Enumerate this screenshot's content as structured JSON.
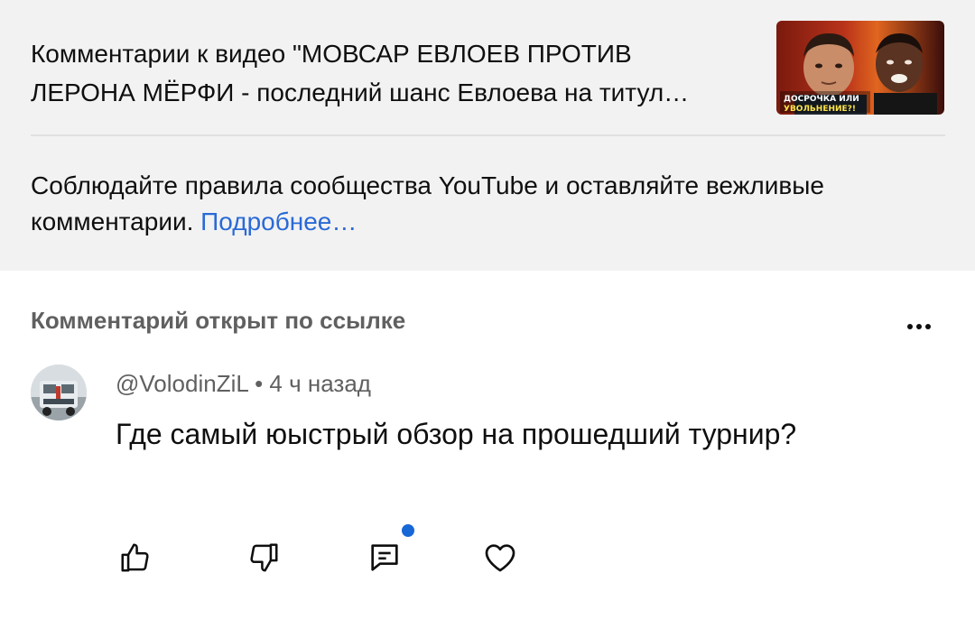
{
  "header": {
    "title_line1": "Комментарии к видео \"МОВСАР ЕВЛОЕВ ПРОТИВ",
    "title_line2": "ЛЕРОНА МЁРФИ - последний шанс Евлоева на титул…",
    "thumbnail_caption_line1": "ДОСРОЧКА ИЛИ",
    "thumbnail_caption_line2": "УВОЛЬНЕНИЕ?!"
  },
  "guidelines": {
    "text": "Соблюдайте правила сообщества YouTube и оставляйте вежливые комментарии.",
    "link": "Подробнее…"
  },
  "comment": {
    "linked_label": "Комментарий открыт по ссылке",
    "author": "@VolodinZiL",
    "separator": " • ",
    "time": "4 ч назад",
    "text": "Где самый юыстрый обзор на прошедший турнир?"
  },
  "colors": {
    "link": "#2a6ad6",
    "header_bg": "#f2f2f2",
    "reply_badge": "#1767d6"
  },
  "icons": {
    "like": "thumb-up-icon",
    "dislike": "thumb-down-icon",
    "reply": "comment-icon",
    "heart": "heart-icon",
    "more": "more-dots-icon"
  }
}
